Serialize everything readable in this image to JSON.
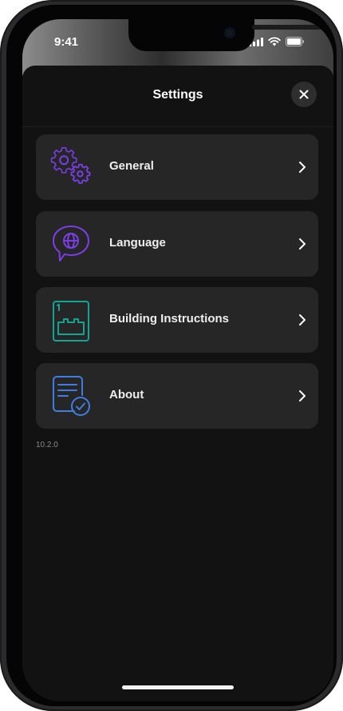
{
  "status_bar": {
    "time": "9:41"
  },
  "header": {
    "title": "Settings"
  },
  "menu": [
    {
      "label": "General",
      "icon": "gear-icon",
      "color": "#7b3ee6"
    },
    {
      "label": "Language",
      "icon": "language-globe-icon",
      "color": "#7b3ee6"
    },
    {
      "label": "Building Instructions",
      "icon": "building-instructions-icon",
      "color": "#15a394"
    },
    {
      "label": "About",
      "icon": "about-document-icon",
      "color": "#3f7ee0"
    }
  ],
  "version": "10.2.0"
}
